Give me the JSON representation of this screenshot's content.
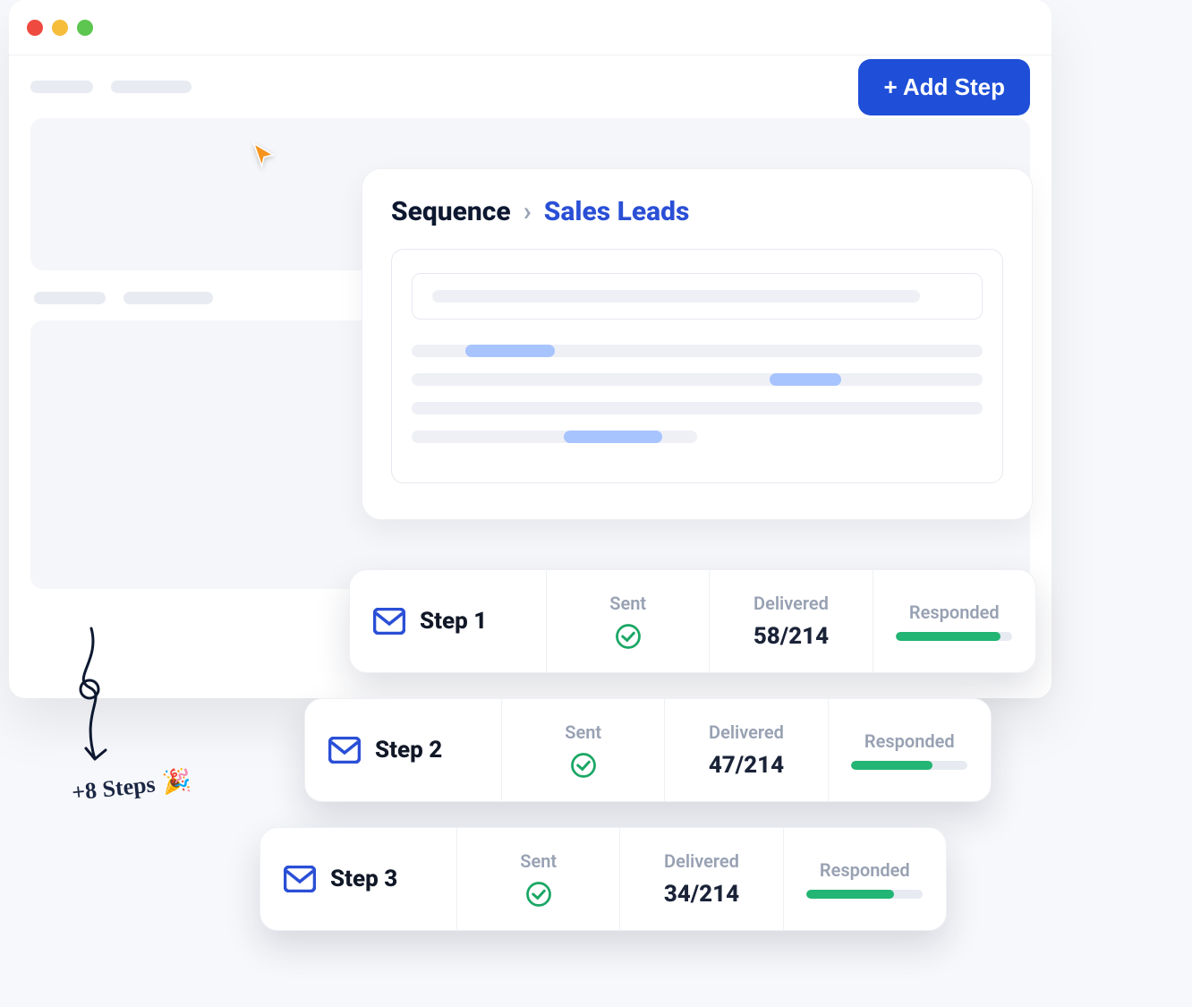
{
  "toolbar": {
    "add_step_label": "+ Add Step"
  },
  "breadcrumb": {
    "root": "Sequence",
    "current": "Sales Leads"
  },
  "columns": {
    "sent": "Sent",
    "delivered": "Delivered",
    "responded": "Responded"
  },
  "steps": [
    {
      "label": "Step 1",
      "delivered": "58/214",
      "responded_pct": 90
    },
    {
      "label": "Step 2",
      "delivered": "47/214",
      "responded_pct": 70
    },
    {
      "label": "Step 3",
      "delivered": "34/214",
      "responded_pct": 75
    }
  ],
  "annotation": {
    "more_steps": "+8 Steps",
    "emoji": "🎉"
  }
}
